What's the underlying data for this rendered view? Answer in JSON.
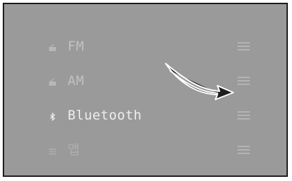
{
  "sources": [
    {
      "label": "FM",
      "icon": "radio-icon"
    },
    {
      "label": "AM",
      "icon": "radio-icon"
    },
    {
      "label": "Bluetooth",
      "icon": "bluetooth-icon"
    },
    {
      "label": "앱",
      "icon": "app-icon"
    }
  ],
  "colors": {
    "background": "#9a9a9a",
    "border": "#1c1c1c",
    "arrow_fill": "#1e1e1e",
    "arrow_outline": "#ffffff"
  }
}
